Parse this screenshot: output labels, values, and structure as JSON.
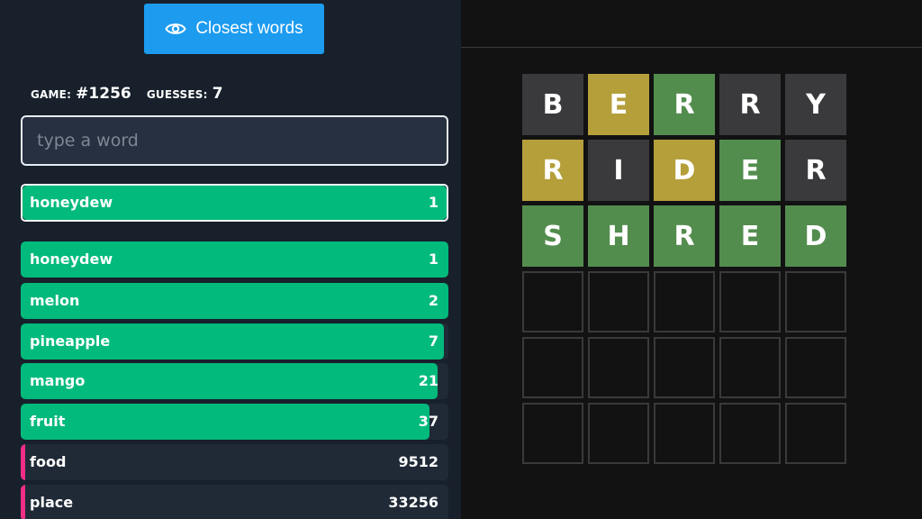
{
  "closest_button": {
    "label": "Closest words",
    "icon": "eye-icon"
  },
  "game": {
    "game_label": "GAME:",
    "game_number": "#1256",
    "guesses_label": "GUESSES:",
    "guesses_count": "7"
  },
  "input": {
    "placeholder": "type a word",
    "value": ""
  },
  "last_guess": {
    "word": "honeydew",
    "rank": "1",
    "fill_fraction": 1.0
  },
  "guesses": [
    {
      "word": "honeydew",
      "rank": "1",
      "fill_fraction": 1.0,
      "highlight": true
    },
    {
      "word": "melon",
      "rank": "2",
      "fill_fraction": 1.0,
      "highlight": false
    },
    {
      "word": "pineapple",
      "rank": "7",
      "fill_fraction": 0.99,
      "highlight": false
    },
    {
      "word": "mango",
      "rank": "21",
      "fill_fraction": 0.975,
      "highlight": false
    },
    {
      "word": "fruit",
      "rank": "37",
      "fill_fraction": 0.955,
      "highlight": false
    },
    {
      "word": "food",
      "rank": "9512",
      "fill_fraction": 0,
      "highlight": false
    },
    {
      "word": "place",
      "rank": "33256",
      "fill_fraction": 0,
      "highlight": false
    }
  ],
  "colors": {
    "correct": "#538d4e",
    "present": "#b59f3b",
    "absent": "#3a3a3c",
    "close_bar": "#02ba7c",
    "far_marker": "#f02d87",
    "button": "#1c9bef"
  },
  "board": [
    [
      {
        "letter": "B",
        "state": "absent"
      },
      {
        "letter": "E",
        "state": "present"
      },
      {
        "letter": "R",
        "state": "correct"
      },
      {
        "letter": "R",
        "state": "absent"
      },
      {
        "letter": "Y",
        "state": "absent"
      }
    ],
    [
      {
        "letter": "R",
        "state": "present"
      },
      {
        "letter": "I",
        "state": "absent"
      },
      {
        "letter": "D",
        "state": "present"
      },
      {
        "letter": "E",
        "state": "correct"
      },
      {
        "letter": "R",
        "state": "absent"
      }
    ],
    [
      {
        "letter": "S",
        "state": "correct"
      },
      {
        "letter": "H",
        "state": "correct"
      },
      {
        "letter": "R",
        "state": "correct"
      },
      {
        "letter": "E",
        "state": "correct"
      },
      {
        "letter": "D",
        "state": "correct"
      }
    ],
    [
      {
        "letter": "",
        "state": "empty"
      },
      {
        "letter": "",
        "state": "empty"
      },
      {
        "letter": "",
        "state": "empty"
      },
      {
        "letter": "",
        "state": "empty"
      },
      {
        "letter": "",
        "state": "empty"
      }
    ],
    [
      {
        "letter": "",
        "state": "empty"
      },
      {
        "letter": "",
        "state": "empty"
      },
      {
        "letter": "",
        "state": "empty"
      },
      {
        "letter": "",
        "state": "empty"
      },
      {
        "letter": "",
        "state": "empty"
      }
    ],
    [
      {
        "letter": "",
        "state": "empty"
      },
      {
        "letter": "",
        "state": "empty"
      },
      {
        "letter": "",
        "state": "empty"
      },
      {
        "letter": "",
        "state": "empty"
      },
      {
        "letter": "",
        "state": "empty"
      }
    ]
  ]
}
